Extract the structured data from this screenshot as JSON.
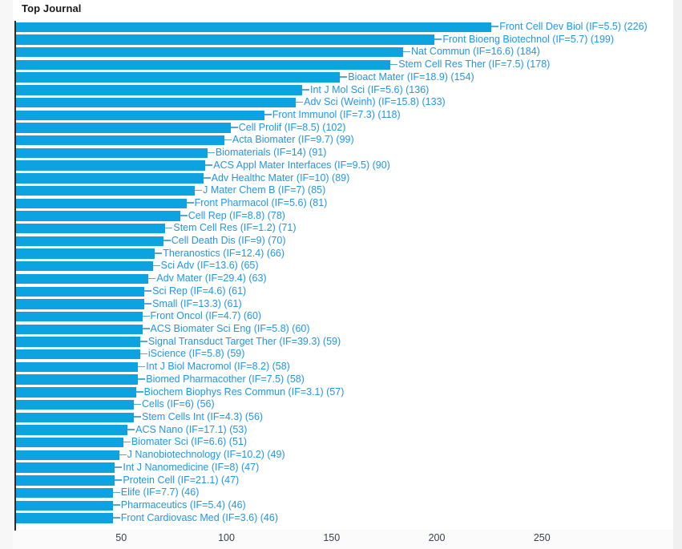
{
  "chart_data": {
    "type": "bar",
    "orientation": "horizontal",
    "title": "Top Journal",
    "xlabel": "",
    "ylabel": "",
    "xlim": [
      0,
      280
    ],
    "xticks": [
      50,
      100,
      150,
      200,
      250
    ],
    "grid": false,
    "legend": null,
    "bar_color": "#0da2e0",
    "label_color": "#2196e8",
    "title_color": "#1a1a1a",
    "axis_color": "#2b2b2b",
    "tick_label_color": "#3a3f4a",
    "background": "#ffffff",
    "page_background": "#f7f7f7",
    "categories": [
      "Front Cell Dev Biol (IF=5.5) (226)",
      "Front Bioeng Biotechnol (IF=5.7) (199)",
      "Nat Commun (IF=16.6) (184)",
      "Stem Cell Res Ther (IF=7.5) (178)",
      "Bioact Mater (IF=18.9) (154)",
      "Int J Mol Sci (IF=5.6) (136)",
      "Adv Sci (Weinh) (IF=15.8) (133)",
      "Front Immunol (IF=7.3) (118)",
      "Cell Prolif (IF=8.5) (102)",
      "Acta Biomater (IF=9.7) (99)",
      "Biomaterials (IF=14) (91)",
      "ACS Appl Mater Interfaces (IF=9.5) (90)",
      "Adv Healthc Mater (IF=10) (89)",
      "J Mater Chem B (IF=7) (85)",
      "Front Pharmacol (IF=5.6) (81)",
      "Cell Rep (IF=8.8) (78)",
      "Stem Cell Res (IF=1.2) (71)",
      "Cell Death Dis (IF=9) (70)",
      "Theranostics (IF=12.4) (66)",
      "Sci Adv (IF=13.6) (65)",
      "Adv Mater (IF=29.4) (63)",
      "Sci Rep (IF=4.6) (61)",
      "Small (IF=13.3) (61)",
      "Front Oncol (IF=4.7) (60)",
      "ACS Biomater Sci Eng (IF=5.8) (60)",
      "Signal Transduct Target Ther (IF=39.3) (59)",
      "iScience (IF=5.8) (59)",
      "Int J Biol Macromol (IF=8.2) (58)",
      "Biomed Pharmacother (IF=7.5) (58)",
      "Biochem Biophys Res Commun (IF=3.1) (57)",
      "Cells (IF=6) (56)",
      "Stem Cells Int (IF=4.3) (56)",
      "ACS Nano (IF=17.1) (53)",
      "Biomater Sci (IF=6.6) (51)",
      "J Nanobiotechnology (IF=10.2) (49)",
      "Int J Nanomedicine (IF=8) (47)",
      "Protein Cell (IF=21.1) (47)",
      "Elife (IF=7.7) (46)",
      "Pharmaceutics (IF=5.4) (46)",
      "Front Cardiovasc Med (IF=3.6) (46)"
    ],
    "journals": [
      "Front Cell Dev Biol",
      "Front Bioeng Biotechnol",
      "Nat Commun",
      "Stem Cell Res Ther",
      "Bioact Mater",
      "Int J Mol Sci",
      "Adv Sci (Weinh)",
      "Front Immunol",
      "Cell Prolif",
      "Acta Biomater",
      "Biomaterials",
      "ACS Appl Mater Interfaces",
      "Adv Healthc Mater",
      "J Mater Chem B",
      "Front Pharmacol",
      "Cell Rep",
      "Stem Cell Res",
      "Cell Death Dis",
      "Theranostics",
      "Sci Adv",
      "Adv Mater",
      "Sci Rep",
      "Small",
      "Front Oncol",
      "ACS Biomater Sci Eng",
      "Signal Transduct Target Ther",
      "iScience",
      "Int J Biol Macromol",
      "Biomed Pharmacother",
      "Biochem Biophys Res Commun",
      "Cells",
      "Stem Cells Int",
      "ACS Nano",
      "Biomater Sci",
      "J Nanobiotechnology",
      "Int J Nanomedicine",
      "Protein Cell",
      "Elife",
      "Pharmaceutics",
      "Front Cardiovasc Med"
    ],
    "impact_factors": [
      5.5,
      5.7,
      16.6,
      7.5,
      18.9,
      5.6,
      15.8,
      7.3,
      8.5,
      9.7,
      14,
      9.5,
      10,
      7,
      5.6,
      8.8,
      1.2,
      9,
      12.4,
      13.6,
      29.4,
      4.6,
      13.3,
      4.7,
      5.8,
      39.3,
      5.8,
      8.2,
      7.5,
      3.1,
      6,
      4.3,
      17.1,
      6.6,
      10.2,
      8,
      21.1,
      7.7,
      5.4,
      3.6
    ],
    "values": [
      226,
      199,
      184,
      178,
      154,
      136,
      133,
      118,
      102,
      99,
      91,
      90,
      89,
      85,
      81,
      78,
      71,
      70,
      66,
      65,
      63,
      61,
      61,
      60,
      60,
      59,
      59,
      58,
      58,
      57,
      56,
      56,
      53,
      51,
      49,
      47,
      47,
      46,
      46,
      46
    ]
  }
}
